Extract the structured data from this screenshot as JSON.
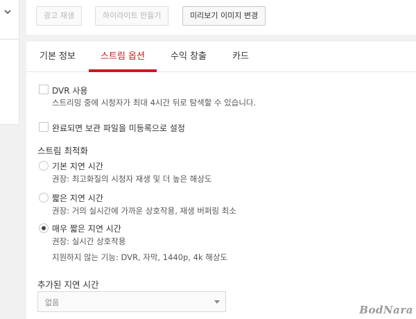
{
  "toolbar": {
    "ad_label": "광고 재생",
    "highlight_label": "하이라이트 만들기",
    "preview_label": "미리보기 이미지 변경"
  },
  "tabs": [
    {
      "label": "기본 정보"
    },
    {
      "label": "스트림 옵션"
    },
    {
      "label": "수익 창출"
    },
    {
      "label": "카드"
    }
  ],
  "dvr": {
    "label": "DVR 사용",
    "description": "스트리밍 중에 시청자가 최대 4시간 뒤로 탐색할 수 있습니다.",
    "checked": false
  },
  "unlisted": {
    "label": "완료되면 보관 파일을 미등록으로 설정",
    "checked": false
  },
  "optimization": {
    "heading": "스트림 최적화",
    "options": [
      {
        "label": "기본 지연 시간",
        "note": "권장: 최고화질의 시청자 재생 및 더 높은 해상도",
        "selected": false
      },
      {
        "label": "짧은 지연 시간",
        "note": "권장: 거의 실시간에 가까운 상호작용, 재생 버퍼링 최소",
        "selected": false
      },
      {
        "label": "매우 짧은 지연 시간",
        "note": "권장: 실시간 상호작용",
        "note2": "지원하지 않는 기능: DVR, 자막, 1440p, 4k 해상도",
        "selected": true
      }
    ]
  },
  "added_latency": {
    "heading": "추가된 지연 시간",
    "value": "없음"
  },
  "watermark": "BodNara",
  "colors": {
    "accent": "#cc181e",
    "background": "#f1f1f1"
  }
}
